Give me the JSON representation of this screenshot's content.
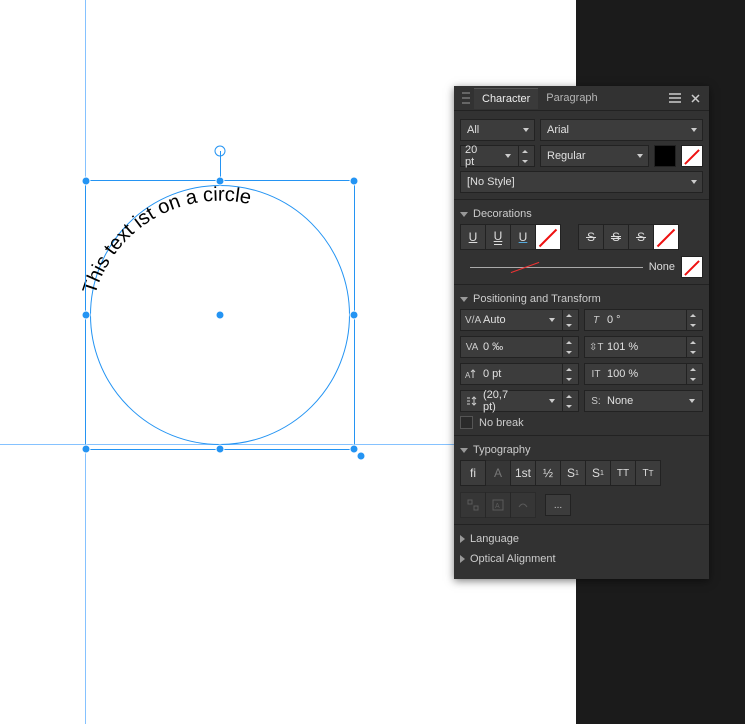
{
  "canvas": {
    "text_on_path": "This text ist on a circle"
  },
  "panel": {
    "tabs": {
      "character": "Character",
      "paragraph": "Paragraph",
      "active": 0
    },
    "font_collection": "All",
    "font_family": "Arial",
    "font_size": "20 pt",
    "font_style": "Regular",
    "char_style": "[No Style]",
    "sections": {
      "decorations": "Decorations",
      "positioning": "Positioning and Transform",
      "typography": "Typography",
      "language": "Language",
      "optical": "Optical Alignment"
    },
    "stroke_style": "None",
    "kerning": "Auto",
    "tracking": "0 ‰",
    "baseline": "0 pt",
    "leading": "(20,7 pt)",
    "shear": "0 °",
    "hscale": "101 %",
    "vscale": "100 %",
    "leading_override": "None",
    "no_break": "No break",
    "typo_btns": {
      "liga": "fi",
      "alt": "A",
      "ord": "1st",
      "frac": "½",
      "sup": "S¹",
      "sub": "S₁",
      "caps": "TT",
      "sc": "Tᴛ"
    },
    "more": "..."
  }
}
